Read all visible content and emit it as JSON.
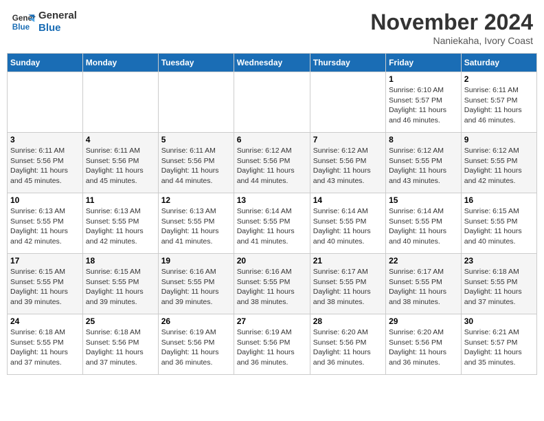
{
  "header": {
    "logo_line1": "General",
    "logo_line2": "Blue",
    "month_year": "November 2024",
    "location": "Naniekaha, Ivory Coast"
  },
  "weekdays": [
    "Sunday",
    "Monday",
    "Tuesday",
    "Wednesday",
    "Thursday",
    "Friday",
    "Saturday"
  ],
  "weeks": [
    [
      {
        "day": "",
        "info": ""
      },
      {
        "day": "",
        "info": ""
      },
      {
        "day": "",
        "info": ""
      },
      {
        "day": "",
        "info": ""
      },
      {
        "day": "",
        "info": ""
      },
      {
        "day": "1",
        "info": "Sunrise: 6:10 AM\nSunset: 5:57 PM\nDaylight: 11 hours\nand 46 minutes."
      },
      {
        "day": "2",
        "info": "Sunrise: 6:11 AM\nSunset: 5:57 PM\nDaylight: 11 hours\nand 46 minutes."
      }
    ],
    [
      {
        "day": "3",
        "info": "Sunrise: 6:11 AM\nSunset: 5:56 PM\nDaylight: 11 hours\nand 45 minutes."
      },
      {
        "day": "4",
        "info": "Sunrise: 6:11 AM\nSunset: 5:56 PM\nDaylight: 11 hours\nand 45 minutes."
      },
      {
        "day": "5",
        "info": "Sunrise: 6:11 AM\nSunset: 5:56 PM\nDaylight: 11 hours\nand 44 minutes."
      },
      {
        "day": "6",
        "info": "Sunrise: 6:12 AM\nSunset: 5:56 PM\nDaylight: 11 hours\nand 44 minutes."
      },
      {
        "day": "7",
        "info": "Sunrise: 6:12 AM\nSunset: 5:56 PM\nDaylight: 11 hours\nand 43 minutes."
      },
      {
        "day": "8",
        "info": "Sunrise: 6:12 AM\nSunset: 5:55 PM\nDaylight: 11 hours\nand 43 minutes."
      },
      {
        "day": "9",
        "info": "Sunrise: 6:12 AM\nSunset: 5:55 PM\nDaylight: 11 hours\nand 42 minutes."
      }
    ],
    [
      {
        "day": "10",
        "info": "Sunrise: 6:13 AM\nSunset: 5:55 PM\nDaylight: 11 hours\nand 42 minutes."
      },
      {
        "day": "11",
        "info": "Sunrise: 6:13 AM\nSunset: 5:55 PM\nDaylight: 11 hours\nand 42 minutes."
      },
      {
        "day": "12",
        "info": "Sunrise: 6:13 AM\nSunset: 5:55 PM\nDaylight: 11 hours\nand 41 minutes."
      },
      {
        "day": "13",
        "info": "Sunrise: 6:14 AM\nSunset: 5:55 PM\nDaylight: 11 hours\nand 41 minutes."
      },
      {
        "day": "14",
        "info": "Sunrise: 6:14 AM\nSunset: 5:55 PM\nDaylight: 11 hours\nand 40 minutes."
      },
      {
        "day": "15",
        "info": "Sunrise: 6:14 AM\nSunset: 5:55 PM\nDaylight: 11 hours\nand 40 minutes."
      },
      {
        "day": "16",
        "info": "Sunrise: 6:15 AM\nSunset: 5:55 PM\nDaylight: 11 hours\nand 40 minutes."
      }
    ],
    [
      {
        "day": "17",
        "info": "Sunrise: 6:15 AM\nSunset: 5:55 PM\nDaylight: 11 hours\nand 39 minutes."
      },
      {
        "day": "18",
        "info": "Sunrise: 6:15 AM\nSunset: 5:55 PM\nDaylight: 11 hours\nand 39 minutes."
      },
      {
        "day": "19",
        "info": "Sunrise: 6:16 AM\nSunset: 5:55 PM\nDaylight: 11 hours\nand 39 minutes."
      },
      {
        "day": "20",
        "info": "Sunrise: 6:16 AM\nSunset: 5:55 PM\nDaylight: 11 hours\nand 38 minutes."
      },
      {
        "day": "21",
        "info": "Sunrise: 6:17 AM\nSunset: 5:55 PM\nDaylight: 11 hours\nand 38 minutes."
      },
      {
        "day": "22",
        "info": "Sunrise: 6:17 AM\nSunset: 5:55 PM\nDaylight: 11 hours\nand 38 minutes."
      },
      {
        "day": "23",
        "info": "Sunrise: 6:18 AM\nSunset: 5:55 PM\nDaylight: 11 hours\nand 37 minutes."
      }
    ],
    [
      {
        "day": "24",
        "info": "Sunrise: 6:18 AM\nSunset: 5:55 PM\nDaylight: 11 hours\nand 37 minutes."
      },
      {
        "day": "25",
        "info": "Sunrise: 6:18 AM\nSunset: 5:56 PM\nDaylight: 11 hours\nand 37 minutes."
      },
      {
        "day": "26",
        "info": "Sunrise: 6:19 AM\nSunset: 5:56 PM\nDaylight: 11 hours\nand 36 minutes."
      },
      {
        "day": "27",
        "info": "Sunrise: 6:19 AM\nSunset: 5:56 PM\nDaylight: 11 hours\nand 36 minutes."
      },
      {
        "day": "28",
        "info": "Sunrise: 6:20 AM\nSunset: 5:56 PM\nDaylight: 11 hours\nand 36 minutes."
      },
      {
        "day": "29",
        "info": "Sunrise: 6:20 AM\nSunset: 5:56 PM\nDaylight: 11 hours\nand 36 minutes."
      },
      {
        "day": "30",
        "info": "Sunrise: 6:21 AM\nSunset: 5:57 PM\nDaylight: 11 hours\nand 35 minutes."
      }
    ]
  ]
}
